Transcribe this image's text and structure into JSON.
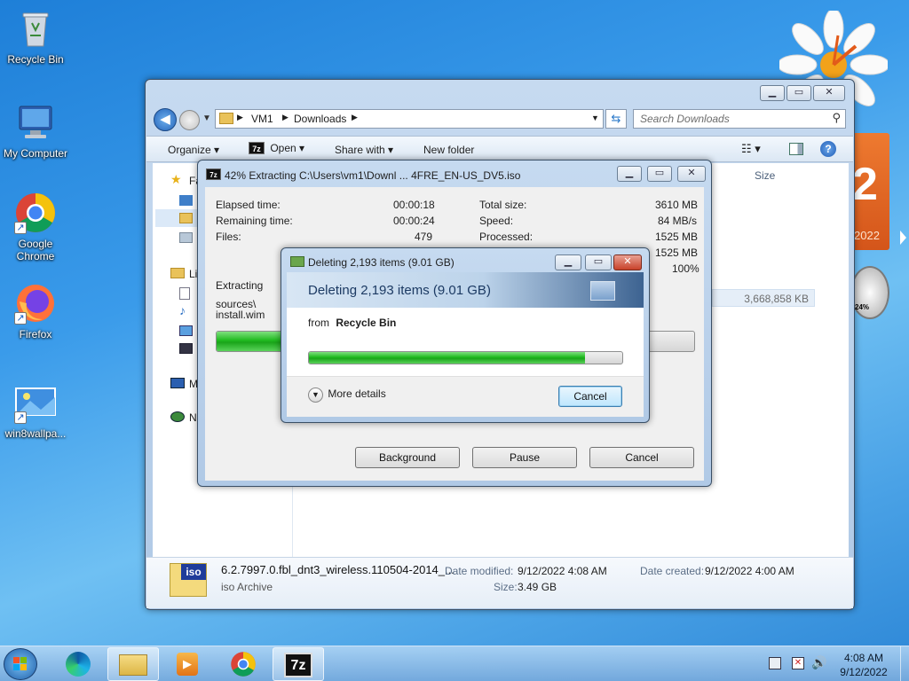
{
  "desktop": {
    "icons": [
      {
        "label": "Recycle Bin"
      },
      {
        "label": "My Computer"
      },
      {
        "label": "Google Chrome"
      },
      {
        "label": "Firefox"
      },
      {
        "label": "win8wallpa..."
      }
    ],
    "calendar_gadget": {
      "day": "2",
      "year": "2022"
    },
    "meter_gadget": {
      "value": "24%"
    }
  },
  "explorer": {
    "breadcrumb": [
      "VM1",
      "Downloads"
    ],
    "search_placeholder": "Search Downloads",
    "toolbar": {
      "organize": "Organize",
      "open": "Open",
      "share_with": "Share with",
      "new_folder": "New folder"
    },
    "nav_partial": {
      "favorites": "Fa",
      "libraries": "Li",
      "my_computer": "M",
      "network": "N"
    },
    "column_size": "Size",
    "row_size": "3,668,858 KB",
    "details": {
      "filename": "6.2.7997.0.fbl_dnt3_wireless.110504-2014_...",
      "type": "iso Archive",
      "date_modified_label": "Date modified:",
      "date_modified": "9/12/2022 4:08 AM",
      "date_created_label": "Date created:",
      "date_created": "9/12/2022 4:00 AM",
      "size_label": "Size:",
      "size": "3.49 GB",
      "icon_text": "iso"
    }
  },
  "extract_dialog": {
    "title": "42% Extracting C:\\Users\\vm1\\Downl ... 4FRE_EN-US_DV5.iso",
    "elapsed_label": "Elapsed time:",
    "elapsed": "00:00:18",
    "remaining_label": "Remaining time:",
    "remaining": "00:00:24",
    "files_label": "Files:",
    "files": "479",
    "total_size_label": "Total size:",
    "total_size": "3610 MB",
    "speed_label": "Speed:",
    "speed": "84 MB/s",
    "processed_label": "Processed:",
    "processed": "1525 MB",
    "packed": "1525 MB",
    "ratio": "100%",
    "extracting_label": "Extracting",
    "path_line1": "sources\\",
    "path_line2": "install.wim",
    "progress": 0.42,
    "buttons": {
      "background": "Background",
      "pause": "Pause",
      "cancel": "Cancel"
    }
  },
  "delete_dialog": {
    "title": "Deleting 2,193 items (9.01 GB)",
    "header": "Deleting 2,193 items (9.01 GB)",
    "from_label": "from",
    "from_location": "Recycle Bin",
    "progress": 0.88,
    "more_details": "More details",
    "cancel": "Cancel"
  },
  "taskbar": {
    "time": "4:08 AM",
    "date": "9/12/2022",
    "sevenzip_label": "7z"
  },
  "colors": {
    "accent": "#2a78c9",
    "progress_green": "#1fba1f",
    "orange_gadget": "#e2631c"
  }
}
